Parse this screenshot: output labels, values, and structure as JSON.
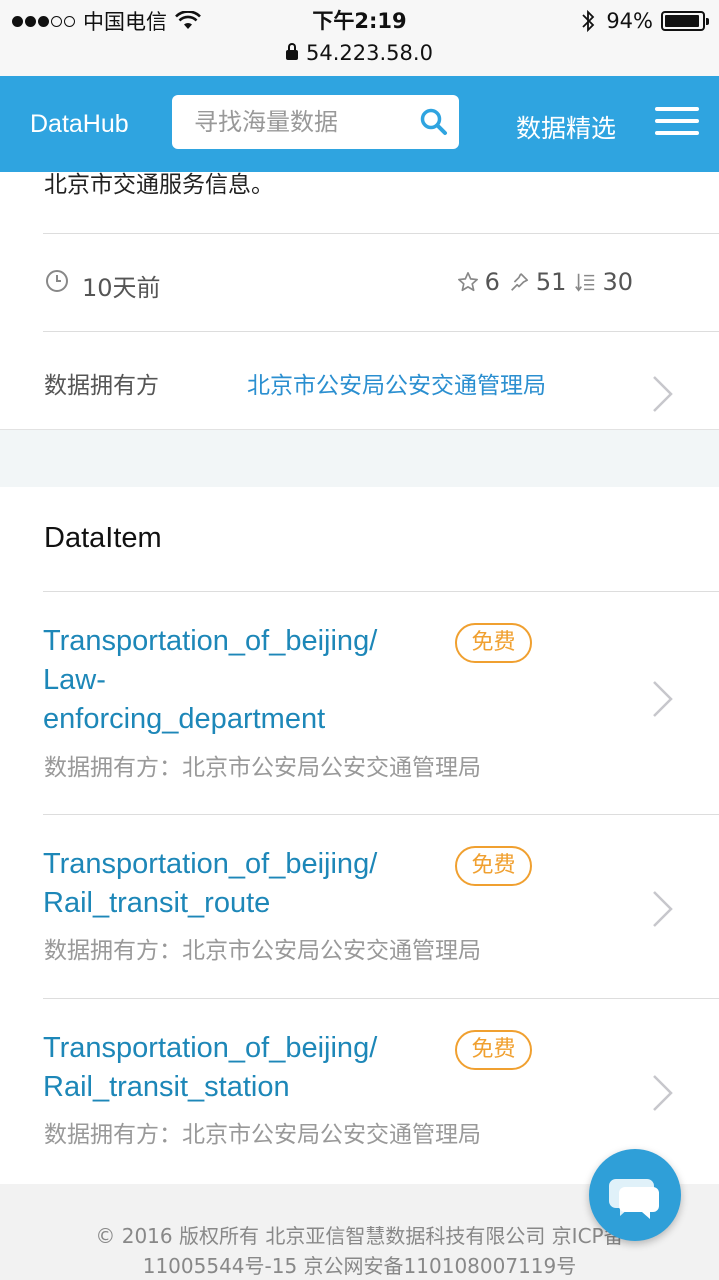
{
  "status_bar": {
    "carrier": "中国电信",
    "time": "下午2:19",
    "battery": "94%",
    "battery_level": 0.94,
    "url": "54.223.58.0"
  },
  "header": {
    "logo": "DataHub",
    "search_placeholder": "寻找海量数据",
    "nav_link": "数据精选"
  },
  "detail": {
    "description": "北京市交通服务信息。",
    "time_ago": "10天前",
    "stars": "6",
    "pins": "51",
    "downloads": "30",
    "owner_label": "数据拥有方",
    "owner_value": "北京市公安局公安交通管理局"
  },
  "data_items": {
    "section_title": "DataItem",
    "items": [
      {
        "title_lines": [
          "Transportation_of_beijing/",
          "Law-",
          "enforcing_department"
        ],
        "badge": "免费",
        "owner": "数据拥有方：北京市公安局公安交通管理局"
      },
      {
        "title_lines": [
          "Transportation_of_beijing/",
          "Rail_transit_route"
        ],
        "badge": "免费",
        "owner": "数据拥有方：北京市公安局公安交通管理局"
      },
      {
        "title_lines": [
          "Transportation_of_beijing/",
          "Rail_transit_station"
        ],
        "badge": "免费",
        "owner": "数据拥有方：北京市公安局公安交通管理局"
      }
    ]
  },
  "footer": {
    "line1": "© 2016 版权所有 北京亚信智慧数据科技有限公司 京ICP备",
    "line2": "11005544号-15 京公网安备110108007119号"
  },
  "icons": {
    "search": "search-icon",
    "menu": "hamburger-menu-icon",
    "clock": "clock-icon",
    "star": "star-icon",
    "pin": "pin-icon",
    "download": "download-list-icon",
    "chevron": "chevron-right-icon",
    "chat": "chat-bubble-icon"
  },
  "colors": {
    "header_bg": "#2fa4e0",
    "link": "#1d87b8",
    "badge": "#f0a030",
    "fab": "#2f9fd8"
  }
}
